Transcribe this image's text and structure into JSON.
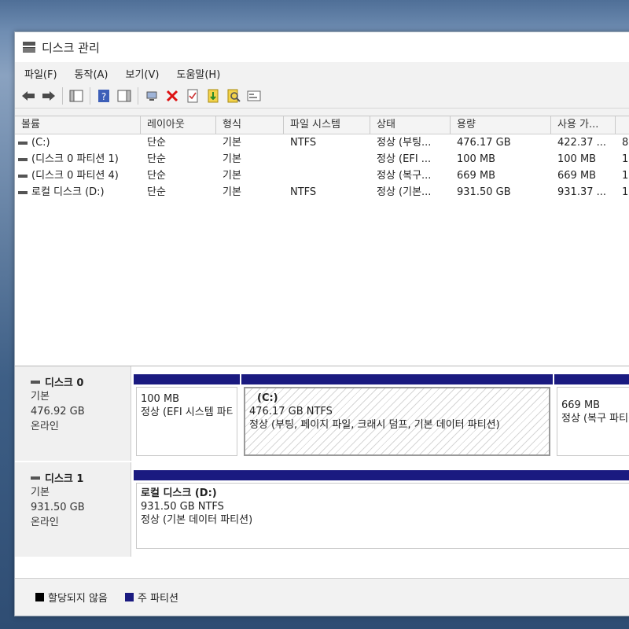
{
  "window": {
    "title": "디스크 관리"
  },
  "menu": [
    {
      "label": "파일(F)"
    },
    {
      "label": "동작(A)"
    },
    {
      "label": "보기(V)"
    },
    {
      "label": "도움말(H)"
    }
  ],
  "toolbar_icons": [
    "back-arrow-icon",
    "forward-arrow-icon",
    "console-tree-icon",
    "help-icon",
    "action-pane-icon",
    "connect-icon",
    "delete-icon",
    "properties-icon",
    "refresh-icon",
    "rescan-icon",
    "export-icon"
  ],
  "columns": [
    "볼륨",
    "레이아웃",
    "형식",
    "파일 시스템",
    "상태",
    "용량",
    "사용 가...",
    ""
  ],
  "volumes": [
    {
      "volume": "(C:)",
      "layout": "단순",
      "type": "기본",
      "fs": "NTFS",
      "status": "정상 (부팅...",
      "capacity": "476.17 GB",
      "free": "422.37 ...",
      "pct": "8"
    },
    {
      "volume": "(디스크 0 파티션 1)",
      "layout": "단순",
      "type": "기본",
      "fs": "",
      "status": "정상 (EFI ...",
      "capacity": "100 MB",
      "free": "100 MB",
      "pct": "1"
    },
    {
      "volume": "(디스크 0 파티션 4)",
      "layout": "단순",
      "type": "기본",
      "fs": "",
      "status": "정상 (복구...",
      "capacity": "669 MB",
      "free": "669 MB",
      "pct": "1"
    },
    {
      "volume": "로컬 디스크 (D:)",
      "layout": "단순",
      "type": "기본",
      "fs": "NTFS",
      "status": "정상 (기본...",
      "capacity": "931.50 GB",
      "free": "931.37 ...",
      "pct": "1"
    }
  ],
  "disks": [
    {
      "name": "디스크 0",
      "kind": "기본",
      "size": "476.92 GB",
      "state": "온라인",
      "partitions": [
        {
          "label": "",
          "size": "100 MB",
          "status": "정상 (EFI 시스템 파티션)"
        },
        {
          "label": "(C:)",
          "size": "476.17 GB NTFS",
          "status": "정상 (부팅, 페이지 파일, 크래시 덤프, 기본 데이터 파티션)"
        },
        {
          "label": "",
          "size": "669 MB",
          "status": "정상 (복구 파티션)"
        }
      ]
    },
    {
      "name": "디스크 1",
      "kind": "기본",
      "size": "931.50 GB",
      "state": "온라인",
      "partitions": [
        {
          "label": "로컬 디스크  (D:)",
          "size": "931.50 GB NTFS",
          "status": "정상 (기본 데이터 파티션)"
        }
      ]
    }
  ],
  "legend": [
    {
      "label": "할당되지 않음",
      "color": "#000000"
    },
    {
      "label": "주 파티션",
      "color": "#1a1a80"
    }
  ],
  "colors": {
    "primary_partition": "#1a1a80",
    "unallocated": "#000000"
  }
}
